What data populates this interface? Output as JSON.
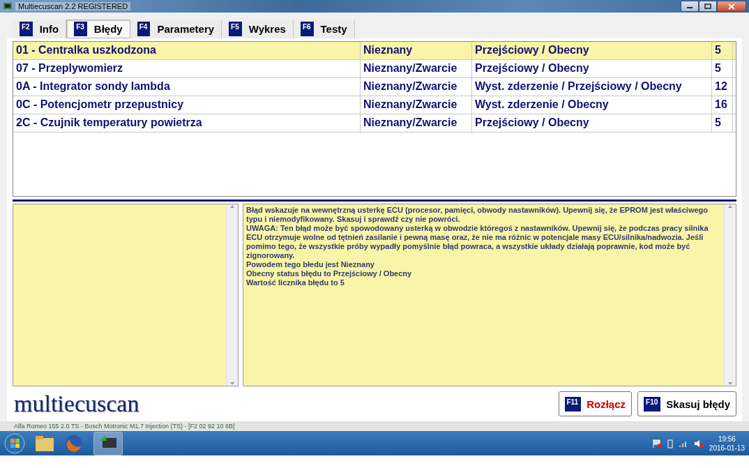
{
  "window": {
    "title": "Multiecuscan 2.2 REGISTERED"
  },
  "tabs": [
    {
      "key": "F2",
      "label": "Info",
      "selected": false
    },
    {
      "key": "F3",
      "label": "Błędy",
      "selected": true
    },
    {
      "key": "F4",
      "label": "Parametery",
      "selected": false
    },
    {
      "key": "F5",
      "label": "Wykres",
      "selected": false
    },
    {
      "key": "F6",
      "label": "Testy",
      "selected": false
    }
  ],
  "faults": [
    {
      "name": "01 - Centralka uszkodzona",
      "cause": "Nieznany",
      "status": "Przejściowy / Obecny",
      "count": "5",
      "selected": true
    },
    {
      "name": "07 - Przeplywomierz",
      "cause": "Nieznany/Zwarcie",
      "status": "Przejściowy / Obecny",
      "count": "5",
      "selected": false
    },
    {
      "name": "0A - Integrator sondy lambda",
      "cause": "Nieznany/Zwarcie",
      "status": "Wyst. zderzenie / Przejściowy / Obecny",
      "count": "12",
      "selected": false
    },
    {
      "name": "0C - Potencjometr przepustnicy",
      "cause": "Nieznany/Zwarcie",
      "status": "Wyst. zderzenie / Obecny",
      "count": "16",
      "selected": false
    },
    {
      "name": "2C - Czujnik temperatury powietrza",
      "cause": "Nieznany/Zwarcie",
      "status": "Przejściowy / Obecny",
      "count": "5",
      "selected": false
    }
  ],
  "description": [
    "Błąd wskazuje na wewnętrzną usterkę ECU (procesor, pamięci, obwody nastawników). Upewnij się, że EPROM jest właściwego typu i niemodyfikowany. Skasuj i sprawdź czy nie powróci.",
    "UWAGA: Ten błąd może być spowodowany usterką w obwodzie któregoś z nastawników. Upewnij się, że podczas pracy silnika ECU otrzymuje wolne od tętnień zasilanie i pewną masę oraz, że nie ma różnic w potencjale masy ECU/silnika/nadwozia. Jeśli pomimo tego, że wszystkie próby wypadły pomyślnie błąd powraca, a wszystkie układy działają poprawnie, kod może być zignorowany.",
    "Powodem tego błedu jest Nieznany",
    "Obecny status błędu to Przejściowy / Obecny",
    "Wartość licznika błędu to 5"
  ],
  "logo": "multiecuscan",
  "buttons": [
    {
      "key": "F11",
      "label": "Rozłącz",
      "kind": "danger"
    },
    {
      "key": "F10",
      "label": "Skasuj błędy",
      "kind": "normal"
    }
  ],
  "status_bar": "Alfa Romeo 155 2.0 TS - Bosch Motronic M1.7 Injection (TS) - [F2 02 92 10 6B]",
  "taskbar": {
    "time": "19:56",
    "date": "2016-01-13"
  }
}
